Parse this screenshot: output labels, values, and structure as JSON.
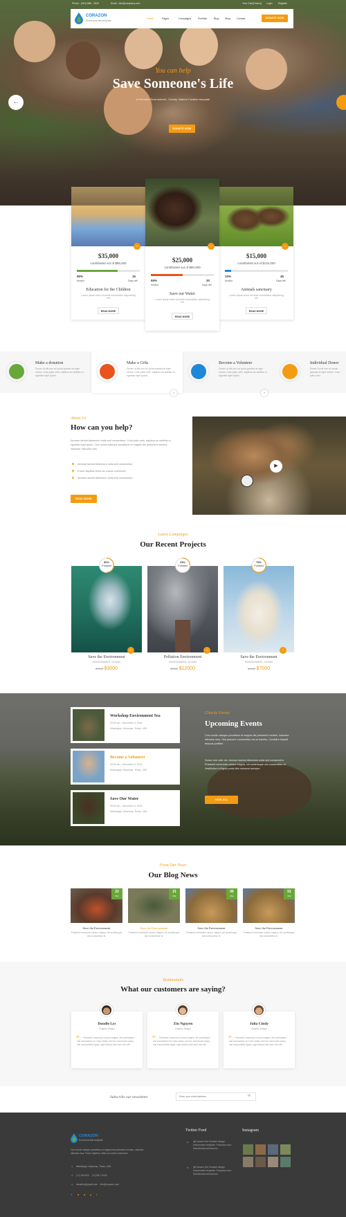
{
  "topbar": {
    "phone": "Phone : (001) 888 - 2620",
    "email": "Email : info@company.com",
    "cart": "Your Cart(0 items)",
    "login": "Login",
    "register": "Register"
  },
  "brand": {
    "name": "CORAZON",
    "tagline": "Environmental template"
  },
  "nav": {
    "items": [
      "Home",
      "Pages",
      "Campaigns",
      "Portfolio",
      "Blog",
      "Shop",
      "Contact"
    ],
    "donate": "DONATE NOW"
  },
  "hero": {
    "subtitle": "You can help",
    "title": "Save Someone's Life",
    "description": "A Premium Environment , Charity, Natural Creative template",
    "button": "DONATE NOW"
  },
  "causes": [
    {
      "amount": "$35,000",
      "goal": "contributed out of $85,000",
      "pct": 65,
      "donors": "15",
      "pct_label": "65%",
      "pct_caption": "funded",
      "days": "Days left",
      "title": "Education for the Children",
      "text": "Lorem ipsum dolor sit amet consectetur adipisicing elit",
      "button": "READ MORE",
      "bar": "#6aa739"
    },
    {
      "amount": "$25,000",
      "goal": "contributed out of $50,000",
      "pct": 50,
      "donors": "30",
      "pct_label": "50%",
      "pct_caption": "funded",
      "days": "Days left",
      "title": "Save our Water",
      "text": "Lorem ipsum dolor sit amet consectetur adipisicing elit",
      "button": "READ MORE",
      "bar": "#e8531e"
    },
    {
      "amount": "$15,000",
      "goal": "contributed out of $115,000",
      "pct": 10,
      "donors": "45",
      "pct_label": "10%",
      "pct_caption": "funded",
      "days": "Days left",
      "title": "Animals sanctuary",
      "text": "Lorem ipsum dolor sit amet consectetur adipisicing elit",
      "button": "READ MORE",
      "bar": "#1e88d8"
    }
  ],
  "helps": [
    {
      "title": "Make a donation",
      "text": "Donec id elit non mi porta gravida at eget metus. Cras justo odio, dapibus ac facilisis in, egestas eget quam.",
      "color": "#6aa739"
    },
    {
      "title": "Make a Gifts",
      "text": "Donec id elit non mi porta gravida at eget metus. Cras justo odio, dapibus ac facilisis in, egestas eget quam.",
      "color": "#e8531e"
    },
    {
      "title": "Become a Volunteer",
      "text": "Donec id elit non mi porta gravida at eget metus. Cras justo odio, dapibus ac facilisis in, egestas eget quam.",
      "color": "#1e88d8"
    },
    {
      "title": "Individual Donor",
      "text": "Donec id elit non mi porta gravida at eget metus. Cras justo odio.",
      "color": "#f39c12"
    }
  ],
  "about": {
    "subtitle": "About Us",
    "title": "How can you help?",
    "text": "Aenean lacinia bibendum nulla sed consectetur. Cras justo odio, dapibus ac facilisis in, egestas eget quam. Cum sociis natoque penatibus et magnis dis parturient montes, nascetur ridiculus mus.",
    "list": [
      "Aenean lacinia bibendum nulla sed consectetur",
      "Fusce dapibus tellus ac cursus commodo",
      "Aenean lacinia bibendum nulla sed consectetur"
    ],
    "button": "READ MORE"
  },
  "projects": {
    "subtitle": "Latest Campaigns",
    "title": "Our Recent Projects",
    "items": [
      {
        "pct": "50%",
        "label": "Funded",
        "title": "Save the Environment",
        "cat": "ENVIRONMENT, OCEAN",
        "old": "$7000",
        "price": "$3000"
      },
      {
        "pct": "25%",
        "label": "Funded",
        "title": "Pollution Environment",
        "cat": "ENVIRONMENT, OCEAN",
        "old": "$9000",
        "price": "$12000"
      },
      {
        "pct": "75%",
        "label": "Funded",
        "title": "Save the Environment",
        "cat": "ENVIRONMENT, OCEAN",
        "old": "$9000",
        "price": "$7000"
      }
    ]
  },
  "events": {
    "subtitle": "Charity Events",
    "title": "Upcoming Events",
    "text1": "Cum sociis natoque penatibus et magnis dis parturient montes, nascetur ridiculus mus. Sed posuere consectetur est at lobortis. Curabitur blandit tempus porttitor.",
    "text2": "Donec sed odio dui. Aenean lacinia bibendum nulla sed consectetur. Praesent commodo cursus magna, vel scelerisque nisl consectetur et. Vestibulum id ligula porta felis euismod semper.",
    "button": "VIEW ALL",
    "items": [
      {
        "title": "Workshop Environment Sea",
        "time": "09:00 am - December 6, 2018",
        "place": "Mississippi, Arkansas, Texas, USA"
      },
      {
        "title": "Become a Volunteer",
        "time": "09:00 am - December 6, 2018",
        "place": "Mississippi, Arkansas, Texas, USA"
      },
      {
        "title": "Save Our Water",
        "time": "09:00 am - December 6, 2018",
        "place": "Mississippi, Arkansas, Texas, USA"
      }
    ]
  },
  "blog": {
    "subtitle": "From Our News",
    "title": "Our Blog News",
    "items": [
      {
        "day": "22",
        "month": "Mar",
        "title": "Save the Environment",
        "text": "Praesent commodo cursus magna, vel scelerisque nisl consectetur et."
      },
      {
        "day": "21",
        "month": "Mar",
        "title": "Save the Environment",
        "text": "Praesent commodo cursus magna, vel scelerisque nisl consectetur et."
      },
      {
        "day": "06",
        "month": "Mar",
        "title": "Save the Environment",
        "text": "Praesent commodo cursus magna, vel scelerisque nisl consectetur et."
      },
      {
        "day": "01",
        "month": "Mar",
        "title": "Save the Environment",
        "text": "Praesent commodo cursus magna, vel scelerisque nisl consectetur et."
      }
    ]
  },
  "testimonials": {
    "subtitle": "Testimonials",
    "title": "What our customers are saying?",
    "items": [
      {
        "name": "Doodle Lys",
        "role": "Graphic Design",
        "text": "Praesent commodo cursus magna, vel scelerisque nisl consectetur et. Duis mollis, est non commodo luctus, nisi erat porttitor ligula, eget lacinia odio sem nec elit."
      },
      {
        "name": "Zin Nguyen",
        "role": "Graphic Design",
        "text": "Praesent commodo cursus magna, vel scelerisque nisl consectetur et. Duis mollis, est non commodo luctus, nisi erat porttitor ligula, eget lacinia odio sem nec elit."
      },
      {
        "name": "Julia Cindy",
        "role": "Graphic Design",
        "text": "Praesent commodo cursus magna, vel scelerisque nisl consectetur et. Duis mollis, est non commodo luctus, nisi erat porttitor ligula, eget lacinia odio sem nec elit."
      }
    ]
  },
  "newsletter": {
    "label": "Subscribe our newsletter",
    "placeholder": "Enter your email address"
  },
  "footer": {
    "about": "Cum sociis natoque penatibus et magnis dis parturient montes, nascetur ridiculus mus. Fusce dapibus, tellus ac cursus commodo.",
    "address": "Mississippi, Arkansas, Texas, USA",
    "phone": "(+1) 98-9222    (+1) 98-7-9333",
    "email": "donation@gmail.com    info@corazon.com",
    "twitter_title": "Twitter Feed",
    "tweet": "@Corazon Hot Creative design environment template. Purchase here: themeforest.net/corazon",
    "instagram_title": "Instagram"
  }
}
